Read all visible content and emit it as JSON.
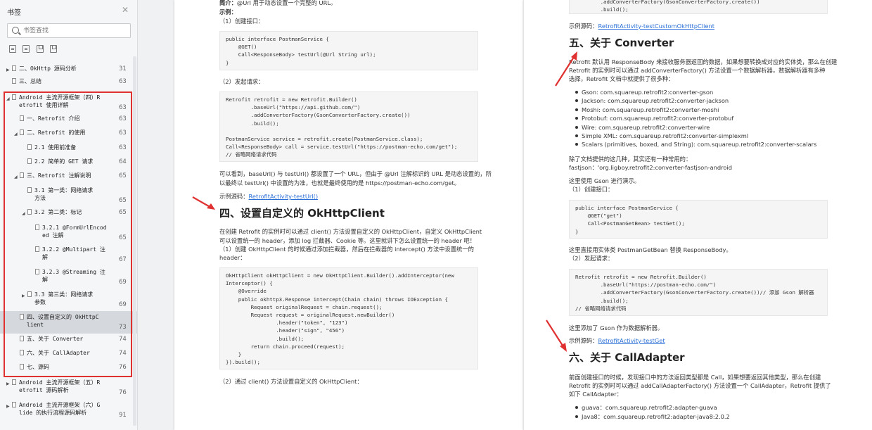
{
  "sidebar": {
    "title": "书签",
    "search_placeholder": "书签查找",
    "toc": [
      {
        "text": "二、OkHttp 源码分析",
        "page": "31",
        "arrow": "▶"
      },
      {
        "text": "三、总结",
        "page": "63",
        "arrow": ""
      },
      {
        "text": "Android 主流开源框架（四）R\netrofit 使用详解",
        "page": "63",
        "arrow": "◢"
      },
      {
        "text": "一、Retrofit 介绍",
        "page": "63",
        "arrow": ""
      },
      {
        "text": "二、Retrofit 的使用",
        "page": "63",
        "arrow": "◢"
      },
      {
        "text": "2.1 使用前准备",
        "page": "63",
        "arrow": ""
      },
      {
        "text": "2.2 简单的 GET 请求",
        "page": "64",
        "arrow": ""
      },
      {
        "text": "三、Retrofit 注解说明",
        "page": "65",
        "arrow": "◢"
      },
      {
        "text": "3.1 第一类：网络请求\n方法",
        "page": "65",
        "arrow": ""
      },
      {
        "text": "3.2 第二类：标记",
        "page": "65",
        "arrow": "◢"
      },
      {
        "text": "3.2.1 @FormUrlEncod\ned 注解",
        "page": "65",
        "arrow": ""
      },
      {
        "text": "3.2.2 @Multipart 注\n解",
        "page": "67",
        "arrow": ""
      },
      {
        "text": "3.2.3 @Streaming 注\n解",
        "page": "69",
        "arrow": ""
      },
      {
        "text": "3.3 第三类：网络请求\n参数",
        "page": "69",
        "arrow": "▶"
      },
      {
        "text": "四、设置自定义的 OkHttpC\nlient",
        "page": "73",
        "arrow": ""
      },
      {
        "text": "五、关于 Converter",
        "page": "74",
        "arrow": ""
      },
      {
        "text": "六、关于 CallAdapter",
        "page": "74",
        "arrow": ""
      },
      {
        "text": "七、源码",
        "page": "76",
        "arrow": ""
      },
      {
        "text": "Android 主流开源框架（五）R\netrofit 源码解析",
        "page": "76",
        "arrow": "▶"
      },
      {
        "text": "Android 主流开源框架（六）G\nlide 的执行流程源码解析",
        "page": "91",
        "arrow": "▶"
      }
    ]
  },
  "page1": {
    "intro_label": "简介：",
    "intro_text": "@Url 用于动态设置一个完整的 URL。",
    "example_label": "示例：",
    "step1": "（1）创建接口：",
    "code1": "public interface PostmanService {\n    @GET()\n    Call<ResponseBody> testUrl(@Url String url);\n}",
    "step2": "（2）发起请求：",
    "code2": "Retrofit retrofit = new Retrofit.Builder()\n        .baseUrl(\"https://api.github.com/\")\n        .addConverterFactory(GsonConverterFactory.create())\n        .build();\n\nPostmanService service = retrofit.create(PostmanService.class);\nCall<ResponseBody> call = service.testUrl(\"https://postman-echo.com/get\");\n// 省略网络请求代码",
    "para1_l1": "可以看到，baseUrl() 与 testUrl() 都设置了一个 URL，但由于 @Url 注解标识的 URL 是动态设置的，所",
    "para1_l2": "以最终以 testUrl() 中设置的为准，也就是最终使用的是 https://postman-echo.com/get。",
    "sample_label": "示例源码：",
    "sample_link": "RetrofitActivity-testUrl()",
    "heading": "四、设置自定义的 OkHttpClient",
    "para2_l1": "在创建 Retrofit 的实例时可以通过 client() 方法设置自定义的 OkHttpClient，自定义 OkHttpClient",
    "para2_l2": "可以设置统一的 header，添加 log 拦截器、Cookie 等。这里就讲下怎么设置统一的 header 吧！",
    "para2_l3": "（1）创建 OkHttpClient 的时候通过添加拦截器，然后在拦截器的 intercept() 方法中设置统一的",
    "para2_l4": "header：",
    "code3": "OkHttpClient okHttpClient = new OkHttpClient.Builder().addInterceptor(new\nInterceptor() {\n    @Override\n    public okhttp3.Response intercept(Chain chain) throws IOException {\n        Request originalRequest = chain.request();\n        Request request = originalRequest.newBuilder()\n                .header(\"token\", \"123\")\n                .header(\"sign\", \"456\")\n                .build();\n        return chain.proceed(request);\n    }\n}).build();",
    "step3": "（2）通过 client() 方法设置自定义的 OkHttpClient："
  },
  "page2": {
    "code_top": "        .addConverterFactory(GsonConverterFactory.create())\n        .build();",
    "sample1_label": "示例源码：",
    "sample1_link": "RetrofitActivity-testCustomOkHttpClient",
    "heading1": "五、关于 Converter",
    "para1_l1": "Retrofit 默认用 ResponseBody 来接收服务器返回的数据，如果想要转换成对应的实体类，那么在创建",
    "para1_l2": "Retrofit 的实例时可以通过 addConverterFactory() 方法设置一个数据解析器，数据解析器有多种",
    "para1_l3": "选择，Retrofit 文档中就提供了很多种：",
    "bullets": [
      "Gson: com.squareup.retrofit2:converter-gson",
      "Jackson: com.squareup.retrofit2:converter-jackson",
      "Moshi: com.squareup.retrofit2:converter-moshi",
      "Protobuf: com.squareup.retrofit2:converter-protobuf",
      "Wire: com.squareup.retrofit2:converter-wire",
      "Simple XML: com.squareup.retrofit2:converter-simplexml",
      "Scalars (primitives, boxed, and String): com.squareup.retrofit2:converter-scalars"
    ],
    "para2_l1": "除了文档提供的这几种，其实还有一种常用的：",
    "para2_l2": "fastjson：'org.ligboy.retrofit2:converter-fastjson-android",
    "para3": "这里使用 Gson 进行演示。",
    "step1": "（1）创建接口：",
    "code1": "public interface PostmanService {\n    @GET(\"get\")\n    Call<PostmanGetBean> testGet();\n}",
    "para4": "这里直接用实体类 PostmanGetBean 替换 ResponseBody。",
    "step2": "（2）发起请求：",
    "code2": "Retrofit retrofit = new Retrofit.Builder()\n        .baseUrl(\"https://postman-echo.com/\")\n        .addConverterFactory(GsonConverterFactory.create())// 添加 Gson 解析器\n        .build();\n// 省略网络请求代码",
    "para5": "这里添加了 Gson 作为数据解析器。",
    "sample2_label": "示例源码：",
    "sample2_link": "RetrofitActivity-testGet",
    "heading2": "六、关于 CallAdapter",
    "para6_l1": "前面创建接口的时候，发现接口中的方法返回类型都是 Call，如果想要返回其他类型，那么在创建",
    "para6_l2": "Retrofit 的实例时可以通过 addCallAdapterFactory() 方法设置一个 CallAdapter，Retrofit 提供了",
    "para6_l3": "如下 CallAdapter：",
    "bullets2": [
      "guava：com.squareup.retrofit2:adapter-guava",
      "Java8：com.squareup.retrofit2:adapter-java8:2.0.2"
    ]
  },
  "colors": {
    "highlight": "#e03131",
    "link": "#2a6fd6"
  }
}
